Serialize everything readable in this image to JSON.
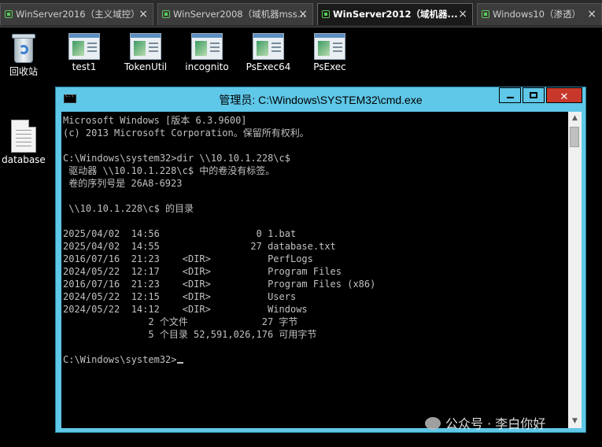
{
  "tabs": [
    {
      "label": "WinServer2016（主义域控）",
      "active": false
    },
    {
      "label": "WinServer2008（域机器mss...",
      "active": false
    },
    {
      "label": "WinServer2012（域机器...",
      "active": true
    },
    {
      "label": "Windows10（渗透）",
      "active": false
    }
  ],
  "tab_close_glyph": "×",
  "desktop": {
    "recycle_bin": "回收站",
    "icons": [
      "test1",
      "TokenUtil",
      "incognito",
      "PsExec64",
      "PsExec"
    ],
    "database": "database"
  },
  "cmd_window": {
    "title": "管理员: C:\\Windows\\SYSTEM32\\cmd.exe",
    "close_glyph": "✕",
    "lines": [
      "Microsoft Windows [版本 6.3.9600]",
      "(c) 2013 Microsoft Corporation。保留所有权利。",
      "",
      "C:\\Windows\\system32>dir \\\\10.10.1.228\\c$",
      " 驱动器 \\\\10.10.1.228\\c$ 中的卷没有标签。",
      " 卷的序列号是 26A8-6923",
      "",
      " \\\\10.10.1.228\\c$ 的目录",
      "",
      "2025/04/02  14:56                 0 1.bat",
      "2025/04/02  14:55                27 database.txt",
      "2016/07/16  21:23    <DIR>          PerfLogs",
      "2024/05/22  12:17    <DIR>          Program Files",
      "2016/07/16  21:23    <DIR>          Program Files (x86)",
      "2024/05/22  12:15    <DIR>          Users",
      "2024/05/22  14:12    <DIR>          Windows",
      "               2 个文件             27 字节",
      "               5 个目录 52,591,026,176 可用字节",
      ""
    ],
    "prompt": "C:\\Windows\\system32>"
  },
  "watermark": "公众号 · 李白你好"
}
